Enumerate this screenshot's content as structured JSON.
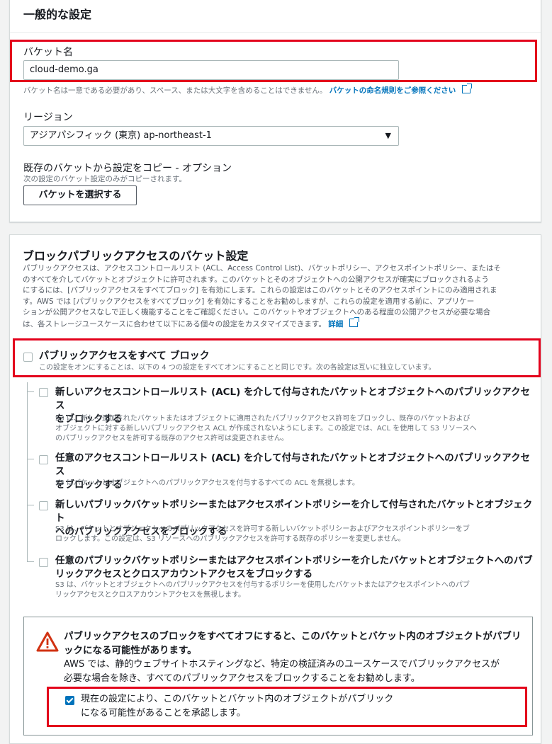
{
  "general": {
    "title": "一般的な設定",
    "bucket_name_label": "バケット名",
    "bucket_name_value": "cloud-demo.ga",
    "bucket_name_hint": "バケット名は一意である必要があり、スペース、または大文字を含めることはできません。",
    "naming_rules_link": "バケットの命名規則をご参照ください",
    "region_label": "リージョン",
    "region_value": "アジアパシフィック (東京) ap-northeast-1",
    "copy_label": "既存のバケットから設定をコピー - オプション",
    "copy_hint": "次の設定のバケット設定のみがコピーされます。",
    "choose_bucket_button": "バケットを選択する"
  },
  "block_public": {
    "title": "ブロックパブリックアクセスのバケット設定",
    "description_lines": [
      "パブリックアクセスは、アクセスコントロールリスト (ACL、Access Control List)、バケットポリシー、アクセスポイントポリシー、またはそ",
      "のすべてを介してバケットとオブジェクトに許可されます。このバケットとそのオブジェクトへの公開アクセスが確実にブロックされるよう",
      "にするには、[パブリックアクセスをすべてブロック] を有効にします。これらの設定はこのバケットとそのアクセスポイントにのみ適用されま",
      "す。AWS では [パブリックアクセスをすべてブロック] を有効にすることをお勧めしますが、これらの設定を適用する前に、アプリケー",
      "ションが公開アクセスなしで正しく機能することをご確認ください。このバケットやオブジェクトへのある程度の公開アクセスが必要な場合",
      "は、各ストレージユースケースに合わせて以下にある個々の設定をカスタマイズできます。"
    ],
    "details_link": "詳細",
    "block_all": {
      "title": "パブリックアクセスをすべて ブロック",
      "description": "この設定をオンにすることは、以下の 4 つの設定をすべてオンにすることと同じです。次の各設定は互いに独立しています。",
      "checked": false
    },
    "options": [
      {
        "title_lines": [
          "新しいアクセスコントロールリスト (ACL) を介して付与されたバケットとオブジェクトへのパブリックアクセス",
          "をブロックする"
        ],
        "desc_lines": [
          "S3 は、新しく追加されたバケットまたはオブジェクトに適用されたパブリックアクセス許可をブロックし、既存のバケットおよび",
          "オブジェクトに対する新しいパブリックアクセス ACL が作成されないようにします。この設定では、ACL を使用して S3 リソースへ",
          "のパブリックアクセスを許可する既存のアクセス許可は変更されません。"
        ],
        "checked": false
      },
      {
        "title_lines": [
          "任意のアクセスコントロールリスト (ACL) を介して付与されたバケットとオブジェクトへのパブリックアクセス",
          "をブロックする"
        ],
        "desc_lines": [
          "S3 はバケットとオブジェクトへのパブリックアクセスを付与するすべての ACL を無視します。"
        ],
        "checked": false
      },
      {
        "title_lines": [
          "新しいパブリックバケットポリシーまたはアクセスポイントポリシーを介して付与されたバケットとオブジェクト",
          "へのパブリックアクセスをブロックする"
        ],
        "desc_lines": [
          "S3 は、バケットとオブジェクトへのパブリックアクセスを許可する新しいバケットポリシーおよびアクセスポイントポリシーをブ",
          "ロックします。この設定は、S3 リソースへのパブリックアクセスを許可する既存のポリシーを変更しません。"
        ],
        "checked": false
      },
      {
        "title_lines": [
          "任意のパブリックバケットポリシーまたはアクセスポイントポリシーを介したバケットとオブジェクトへのパブ",
          "リックアクセスとクロスアカウントアクセスをブロックする"
        ],
        "desc_lines": [
          "S3 は、バケットとオブジェクトへのパブリックアクセスを付与するポリシーを使用したバケットまたはアクセスポイントへのパブ",
          "リックアクセスとクロスアカウントアクセスを無視します。"
        ],
        "checked": false
      }
    ]
  },
  "warning": {
    "title_lines": [
      "パブリックアクセスのブロックをすべてオフにすると、このバケットとバケット内のオブジェクトがパブリ",
      "ックになる可能性があります。"
    ],
    "body_lines": [
      "AWS では、静的ウェブサイトホスティングなど、特定の検証済みのユースケースでパブリックアクセスが",
      "必要な場合を除き、すべてのパブリックアクセスをブロックすることをお勧めします。"
    ],
    "ack_lines": [
      "現在の設定により、このバケットとバケット内のオブジェクトがパブリック",
      "になる可能性があることを承認します。"
    ],
    "ack_checked": true,
    "icon_color": "#d13212"
  },
  "colors": {
    "highlight": "#e3001b",
    "link": "#0073bb"
  }
}
